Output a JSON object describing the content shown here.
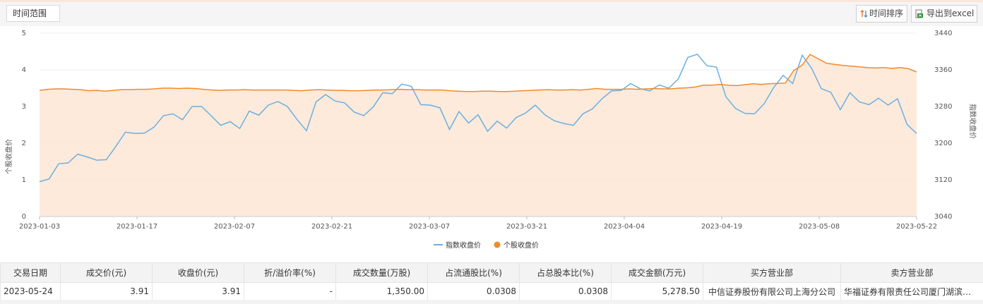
{
  "toolbar": {
    "range_label": "时间范围",
    "sort_label": "时间排序",
    "export_label": "导出到excel",
    "sort_icon": "sort-arrows-icon",
    "export_icon": "excel-export-icon"
  },
  "chart_data": {
    "type": "line",
    "y_left_label": "个股收盘价",
    "y_right_label": "指数收盘价",
    "y_left_range": [
      0,
      5
    ],
    "y_left_ticks": [
      "0",
      "1",
      "2",
      "3",
      "4",
      "5"
    ],
    "y_right_range": [
      3040,
      3440
    ],
    "y_right_ticks": [
      "3040",
      "3120",
      "3200",
      "3280",
      "3360",
      "3440"
    ],
    "x_tick_labels": [
      "2023-01-03",
      "2023-01-17",
      "2023-02-07",
      "2023-02-21",
      "2023-03-07",
      "2023-03-21",
      "2023-04-04",
      "2023-04-19",
      "2023-05-08",
      "2023-05-22"
    ],
    "legend_position": "bottom-center",
    "series": [
      {
        "name": "指数收盘价",
        "axis": "right",
        "color": "#6ab0e0",
        "values": [
          3116,
          3122,
          3155,
          3157,
          3176,
          3170,
          3163,
          3164,
          3193,
          3224,
          3221,
          3222,
          3235,
          3260,
          3264,
          3251,
          3280,
          3280,
          3260,
          3239,
          3247,
          3232,
          3270,
          3261,
          3283,
          3291,
          3280,
          3252,
          3227,
          3290,
          3306,
          3292,
          3288,
          3268,
          3260,
          3279,
          3310,
          3308,
          3329,
          3324,
          3284,
          3283,
          3277,
          3230,
          3269,
          3244,
          3262,
          3226,
          3248,
          3233,
          3256,
          3266,
          3283,
          3262,
          3249,
          3243,
          3239,
          3264,
          3275,
          3297,
          3314,
          3315,
          3330,
          3319,
          3314,
          3327,
          3320,
          3340,
          3387,
          3394,
          3369,
          3366,
          3301,
          3276,
          3265,
          3264,
          3286,
          3321,
          3348,
          3330,
          3392,
          3363,
          3319,
          3311,
          3273,
          3310,
          3290,
          3284,
          3298,
          3283,
          3297,
          3241,
          3221
        ]
      },
      {
        "name": "个股收盘价",
        "axis": "left",
        "color": "#f08a2c",
        "values": [
          3.44,
          3.47,
          3.48,
          3.48,
          3.47,
          3.46,
          3.43,
          3.44,
          3.42,
          3.44,
          3.46,
          3.46,
          3.47,
          3.47,
          3.48,
          3.5,
          3.5,
          3.49,
          3.5,
          3.49,
          3.47,
          3.45,
          3.44,
          3.45,
          3.45,
          3.46,
          3.45,
          3.45,
          3.45,
          3.45,
          3.45,
          3.44,
          3.43,
          3.45,
          3.46,
          3.45,
          3.44,
          3.44,
          3.43,
          3.43,
          3.44,
          3.45,
          3.45,
          3.46,
          3.47,
          3.46,
          3.46,
          3.45,
          3.45,
          3.45,
          3.43,
          3.42,
          3.41,
          3.41,
          3.42,
          3.42,
          3.41,
          3.41,
          3.42,
          3.43,
          3.44,
          3.45,
          3.46,
          3.45,
          3.45,
          3.46,
          3.45,
          3.47,
          3.49,
          3.47,
          3.47,
          3.47,
          3.48,
          3.47,
          3.48,
          3.49,
          3.48,
          3.48,
          3.5,
          3.51,
          3.53,
          3.58,
          3.58,
          3.6,
          3.58,
          3.57,
          3.59,
          3.62,
          3.6,
          3.62,
          3.63,
          3.64,
          3.98,
          4.12,
          4.42,
          4.3,
          4.18,
          4.15,
          4.12,
          4.1,
          4.08,
          4.06,
          4.05,
          4.06,
          4.04,
          4.06,
          4.03,
          3.94
        ]
      }
    ]
  },
  "table": {
    "headers": [
      "交易日期",
      "成交价(元)",
      "收盘价(元)",
      "折/溢价率(%)",
      "成交数量(万股)",
      "占流通股比(%)",
      "占总股本比(%)",
      "成交金额(万元)",
      "买方营业部",
      "卖方营业部"
    ],
    "rows": [
      [
        "2023-05-24",
        "3.91",
        "3.91",
        "-",
        "1,350.00",
        "0.0308",
        "0.0308",
        "5,278.50",
        "中信证券股份有限公司上海分公司",
        "华福证券有限责任公司厦门湖滨…"
      ]
    ]
  }
}
